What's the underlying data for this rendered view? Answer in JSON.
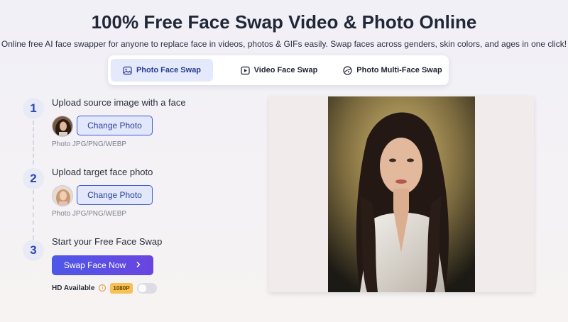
{
  "header": {
    "title": "100% Free Face Swap Video & Photo Online",
    "subtitle": "Online free AI face swapper for anyone to replace face in videos, photos & GIFs easily. Swap faces across genders, skin colors, and ages in one click!"
  },
  "tabs": [
    {
      "label": "Photo Face Swap",
      "icon": "image-icon",
      "active": true
    },
    {
      "label": "Video Face Swap",
      "icon": "play-icon",
      "active": false
    },
    {
      "label": "Photo Multi-Face Swap",
      "icon": "multi-face-icon",
      "active": false
    }
  ],
  "steps": [
    {
      "number": "1",
      "label": "Upload source image with a face",
      "button": "Change Photo",
      "formats": "Photo JPG/PNG/WEBP"
    },
    {
      "number": "2",
      "label": "Upload target face photo",
      "button": "Change Photo",
      "formats": "Photo JPG/PNG/WEBP"
    },
    {
      "number": "3",
      "label": "Start your Free Face Swap",
      "button": "Swap Face Now"
    }
  ],
  "hd": {
    "label": "HD Available",
    "badge": "1080P",
    "enabled": false
  },
  "colors": {
    "accent": "#3d5bd3",
    "button_gradient_start": "#4e58e8",
    "button_gradient_end": "#6a44e0",
    "badge": "#f6c155"
  }
}
